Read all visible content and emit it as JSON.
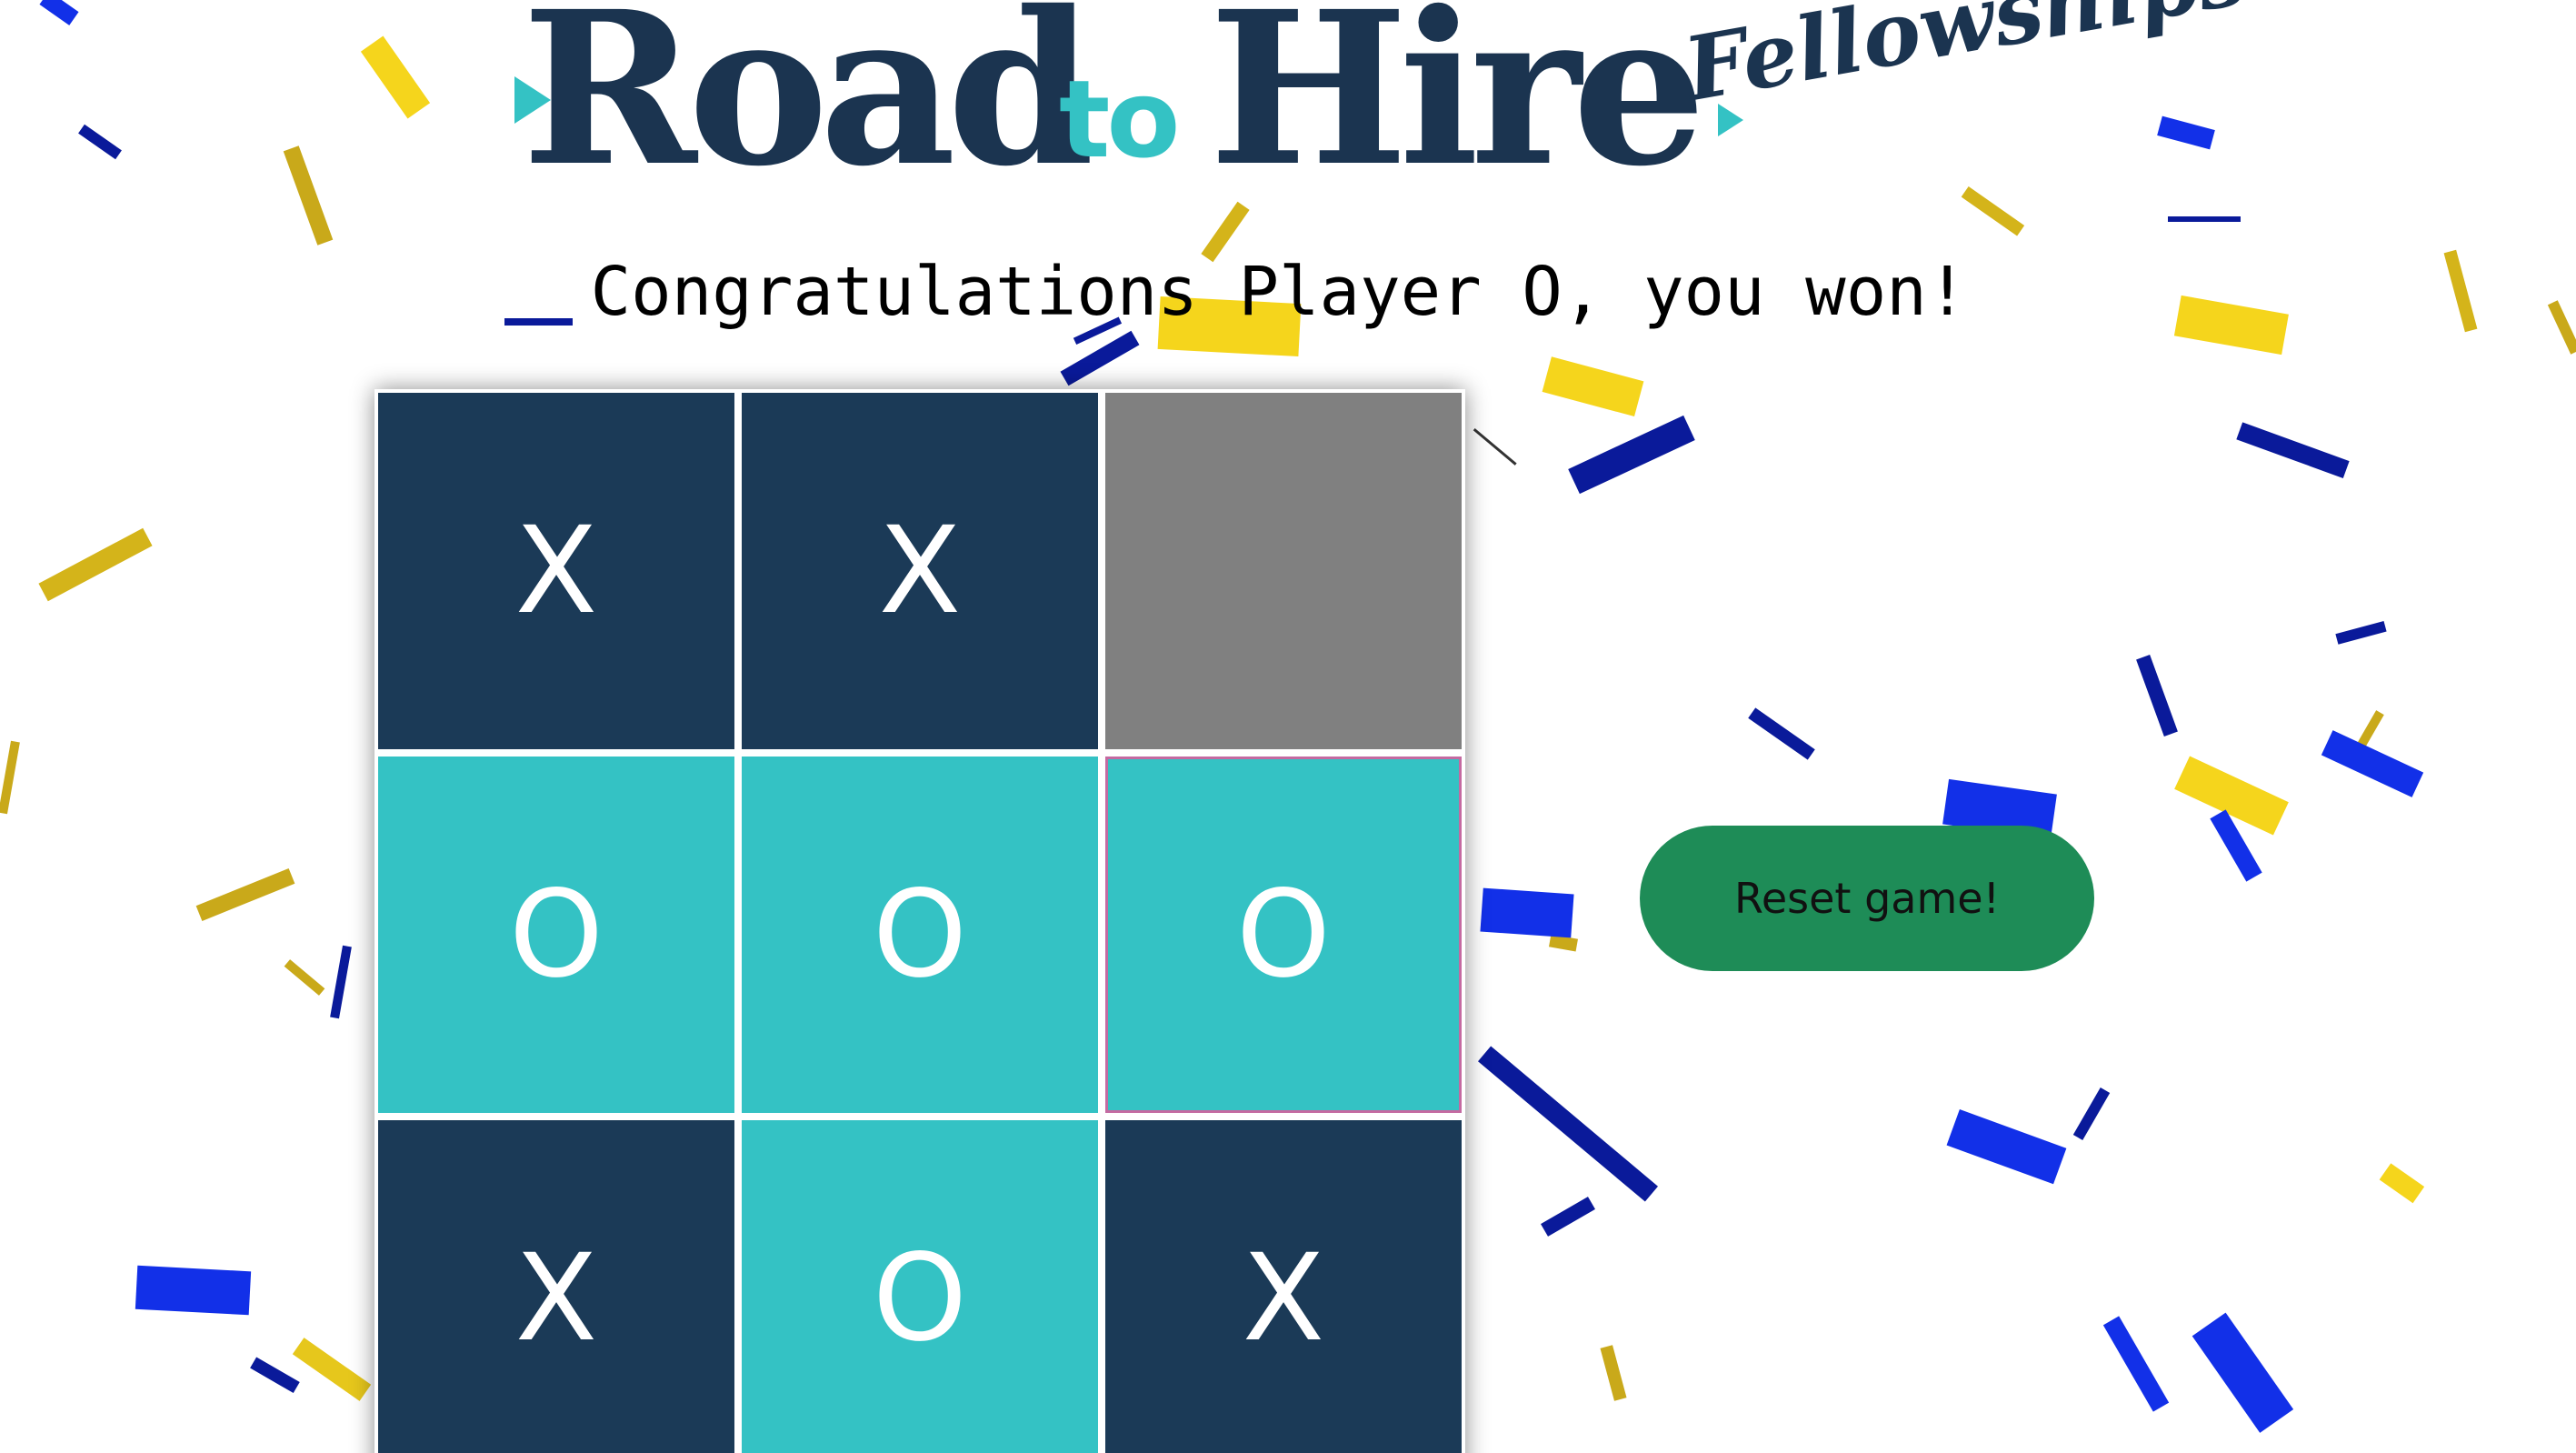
{
  "logo": {
    "road": "Road",
    "to": "to",
    "hire": "Hire",
    "fellowships": "Fellowships"
  },
  "status": {
    "message": "Congratulations Player O, you won!"
  },
  "board": {
    "cells": [
      "X",
      "X",
      "",
      "O",
      "O",
      "O",
      "X",
      "O",
      "X"
    ]
  },
  "controls": {
    "reset_label": "Reset game!"
  },
  "colors": {
    "x_cell": "#1b3a57",
    "o_cell": "#34c2c4",
    "empty_cell": "#808080",
    "reset_button": "#1e8c57",
    "logo_navy": "#1b3450",
    "logo_teal": "#34c2c4",
    "confetti_yellow": "#f5d51c",
    "confetti_gold": "#c9a91a",
    "confetti_blue": "#1230e8",
    "confetti_navy": "#0a1a9a"
  }
}
